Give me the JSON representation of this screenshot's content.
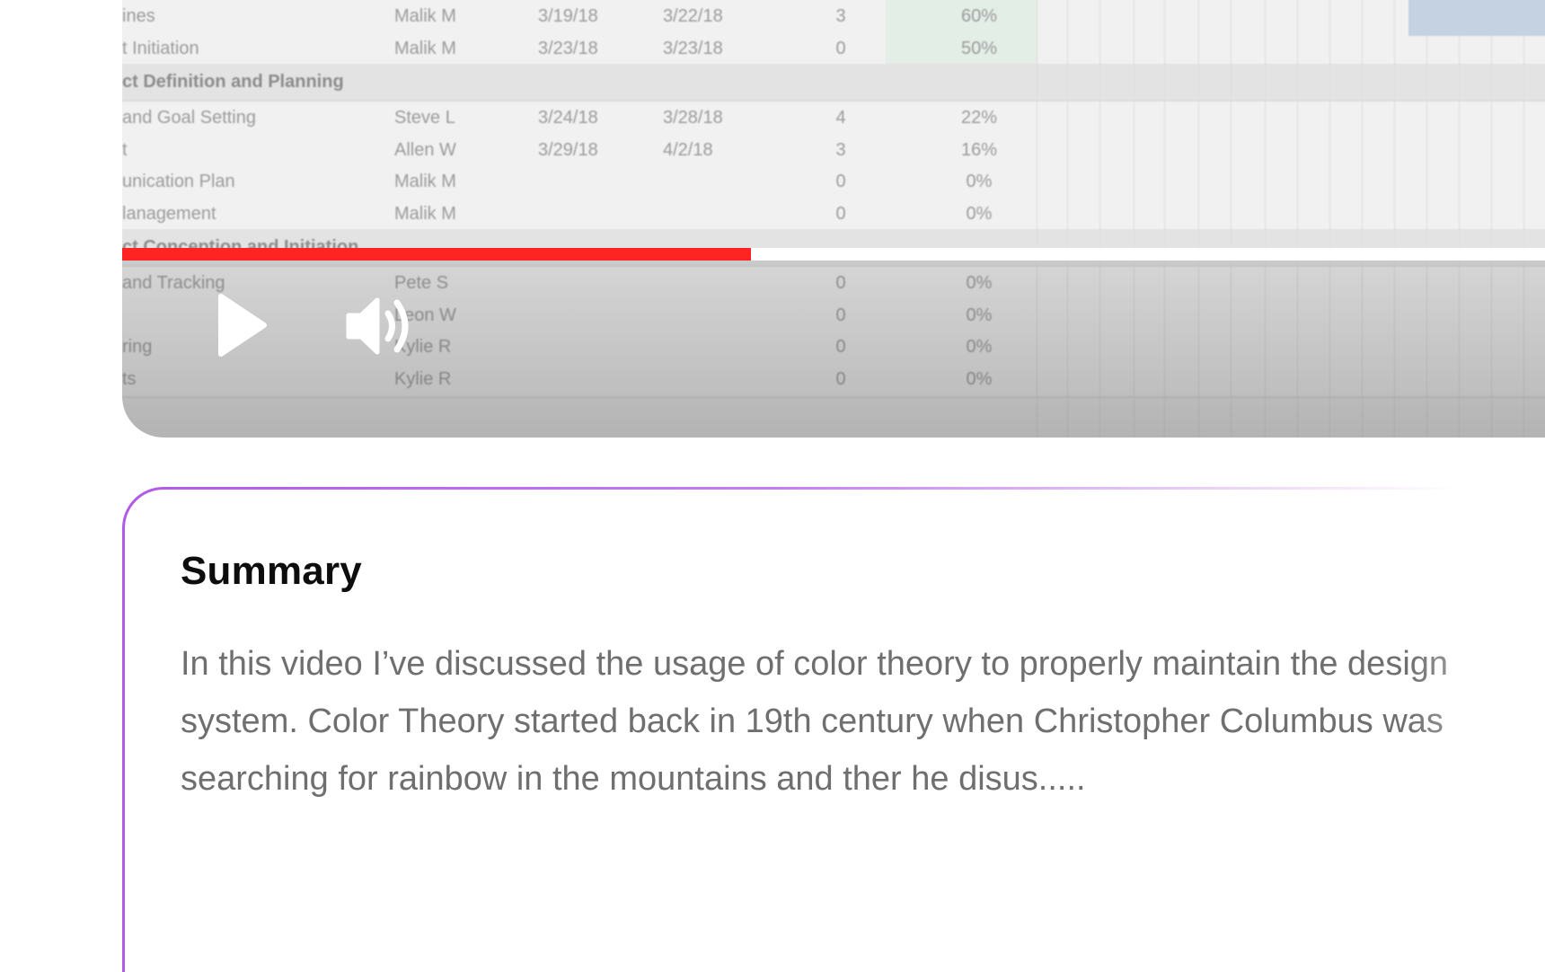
{
  "video": {
    "tasks": [
      {
        "type": "task",
        "name": "ines",
        "assignee": "Malik M",
        "start": "3/19/18",
        "end": "3/22/18",
        "days": "3",
        "status": "60%"
      },
      {
        "type": "task",
        "name": "t Initiation",
        "assignee": "Malik M",
        "start": "3/23/18",
        "end": "3/23/18",
        "days": "0",
        "status": "50%"
      },
      {
        "type": "section",
        "name": "ct Definition and Planning"
      },
      {
        "type": "task",
        "name": "and Goal Setting",
        "assignee": "Steve L",
        "start": "3/24/18",
        "end": "3/28/18",
        "days": "4",
        "status": "22%"
      },
      {
        "type": "task",
        "name": "t",
        "assignee": "Allen W",
        "start": "3/29/18",
        "end": "4/2/18",
        "days": "3",
        "status": "16%"
      },
      {
        "type": "task",
        "name": "unication Plan",
        "assignee": "Malik M",
        "start": "",
        "end": "",
        "days": "0",
        "status": "0%"
      },
      {
        "type": "task",
        "name": "lanagement",
        "assignee": "Malik M",
        "start": "",
        "end": "",
        "days": "0",
        "status": "0%"
      },
      {
        "type": "section",
        "name": "ct Conception and Initiation"
      },
      {
        "type": "task",
        "name": "and Tracking",
        "assignee": "Pete S",
        "start": "",
        "end": "",
        "days": "0",
        "status": "0%"
      },
      {
        "type": "task",
        "name": "",
        "assignee": "Leon W",
        "start": "",
        "end": "",
        "days": "0",
        "status": "0%"
      },
      {
        "type": "task",
        "name": "ring",
        "assignee": "Kylie R",
        "start": "",
        "end": "",
        "days": "0",
        "status": "0%"
      },
      {
        "type": "task",
        "name": "ts",
        "assignee": "Kylie R",
        "start": "",
        "end": "",
        "days": "0",
        "status": "0%"
      }
    ],
    "progress_fraction": 0.432,
    "controls": {
      "play_icon": "play-icon",
      "volume_icon": "volume-icon"
    },
    "colors": {
      "progress": "#ff2424",
      "gantt_bar": "#c5d2e2"
    }
  },
  "summary": {
    "title": "Summary",
    "text": "In this video I’ve discussed the usage of color theory to properly maintain the design system. Color Theory started back in 19th century when Christopher Columbus was searching for rainbow in the mountains and ther he disus.....",
    "colors": {
      "border_gradient_start": "#b25ae8"
    }
  }
}
